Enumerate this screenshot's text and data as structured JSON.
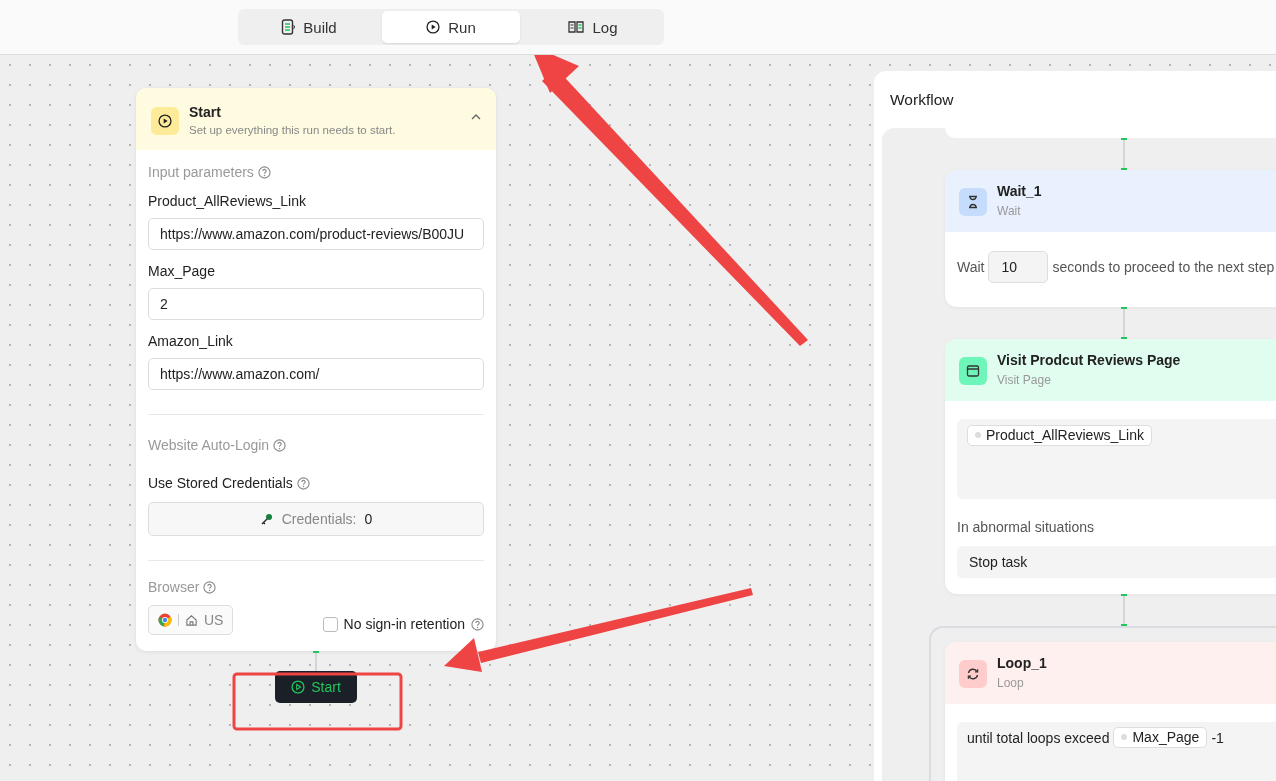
{
  "tabs": [
    {
      "label": "Build",
      "kind": "build",
      "selected": false
    },
    {
      "label": "Run",
      "kind": "run",
      "selected": true
    },
    {
      "label": "Log",
      "kind": "log",
      "selected": false
    }
  ],
  "start_panel": {
    "title": "Start",
    "subtitle": "Set up everything this run needs to start.",
    "expanded": true,
    "input_parameters_label": "Input parameters",
    "parameters": [
      {
        "name": "Product_AllReviews_Link",
        "value": "https://www.amazon.com/product-reviews/B00JU"
      },
      {
        "name": "Max_Page",
        "value": "2"
      },
      {
        "name": "Amazon_Link",
        "value": "https://www.amazon.com/"
      }
    ],
    "auto_login_label": "Website Auto-Login",
    "stored_credentials_label": "Use Stored Credentials",
    "credentials_label": "Credentials:",
    "credentials_count": "0",
    "browser_label": "Browser",
    "browser_region": "US",
    "no_sign_in_retention": {
      "label": "No sign-in retention",
      "checked": false
    }
  },
  "start_button": "Start",
  "workflow": {
    "title": "Workflow",
    "nodes": [
      {
        "kind": "wait",
        "title": "Wait_1",
        "type": "Wait",
        "prefix": "Wait",
        "value": "10",
        "suffix": "seconds to proceed to the next step"
      },
      {
        "kind": "visit",
        "title": "Visit Prodcut Reviews Page",
        "type": "Visit Page",
        "chip": "Product_AllReviews_Link",
        "abnormal_label": "In abnormal situations",
        "abnormal_action": "Stop task"
      },
      {
        "kind": "loop",
        "title": "Loop_1",
        "type": "Loop",
        "prefix": "until total loops exceed",
        "chip": "Max_Page",
        "suffix": "-1"
      }
    ]
  }
}
